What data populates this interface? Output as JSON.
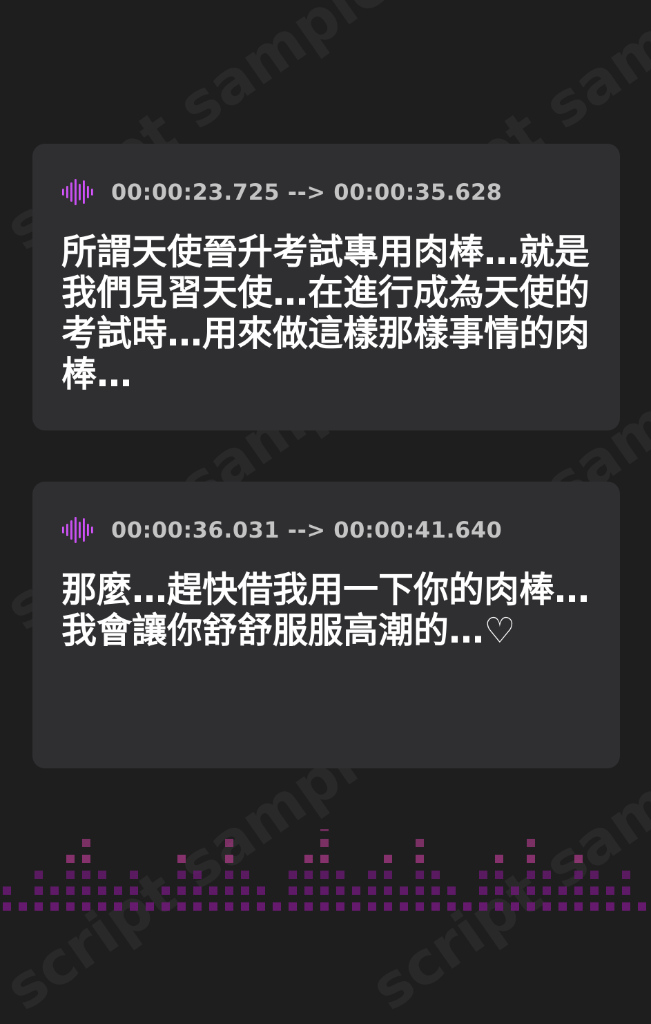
{
  "watermark_text": "script sample",
  "cards": [
    {
      "timestamp": "00:00:23.725 --> 00:00:35.628",
      "text": "所謂天使晉升考試專用肉棒…就是我們見習天使…在進行成為天使的考試時…用來做這樣那樣事情的肉棒…"
    },
    {
      "timestamp": "00:00:36.031 --> 00:00:41.640",
      "text": "那麼…趕快借我用一下你的肉棒…我會讓你舒舒服服高潮的…♡"
    }
  ],
  "colors": {
    "background": "#1e1e1f",
    "card": "#2f2f31",
    "timestamp": "#c4c4c4",
    "text": "#ffffff",
    "icon_gradient_start": "#e060ff",
    "icon_gradient_end": "#b040e0",
    "equalizer_dark": "#7a1a7a",
    "equalizer_light": "#c8307a"
  },
  "icons": {
    "card_icon": "audio-waveform-icon"
  }
}
